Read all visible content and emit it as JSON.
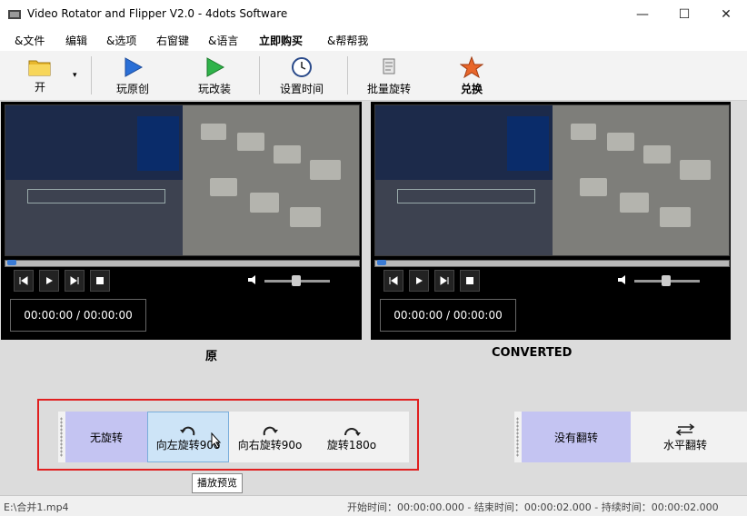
{
  "window": {
    "title": "Video Rotator and Flipper V2.0 - 4dots Software",
    "controls": {
      "minimize": "—",
      "maximize": "☐",
      "close": "✕"
    }
  },
  "menu": [
    "&文件",
    "编辑",
    "&选项",
    "右窗键",
    "&语言",
    "立即购买",
    "&帮帮我"
  ],
  "toolbar": {
    "open": "开",
    "play_original": "玩原创",
    "play_converted": "玩改装",
    "set_time": "设置时间",
    "batch_rotate": "批量旋转",
    "convert": "兑换"
  },
  "panes": {
    "original_time": "00:00:00 / 00:00:00",
    "converted_time": "00:00:00 / 00:00:00",
    "original_label": "原",
    "converted_label": "CONVERTED"
  },
  "rotation": {
    "none": "无旋转",
    "left90": "向左旋转90o",
    "right90": "向右旋转90o",
    "rotate180": "旋转180o"
  },
  "flip": {
    "none": "没有翻转",
    "horizontal": "水平翻转"
  },
  "tooltip": "播放预览",
  "status": {
    "file": "E:\\合并1.mp4",
    "times": "开始时间：00:00:00.000 - 结束时间：00:00:02.000 - 持续时间：00:00:02.000"
  },
  "colors": {
    "selected_option": "#c4c4f2",
    "hover_option": "#cde4f7",
    "highlight_border": "#e02020"
  }
}
